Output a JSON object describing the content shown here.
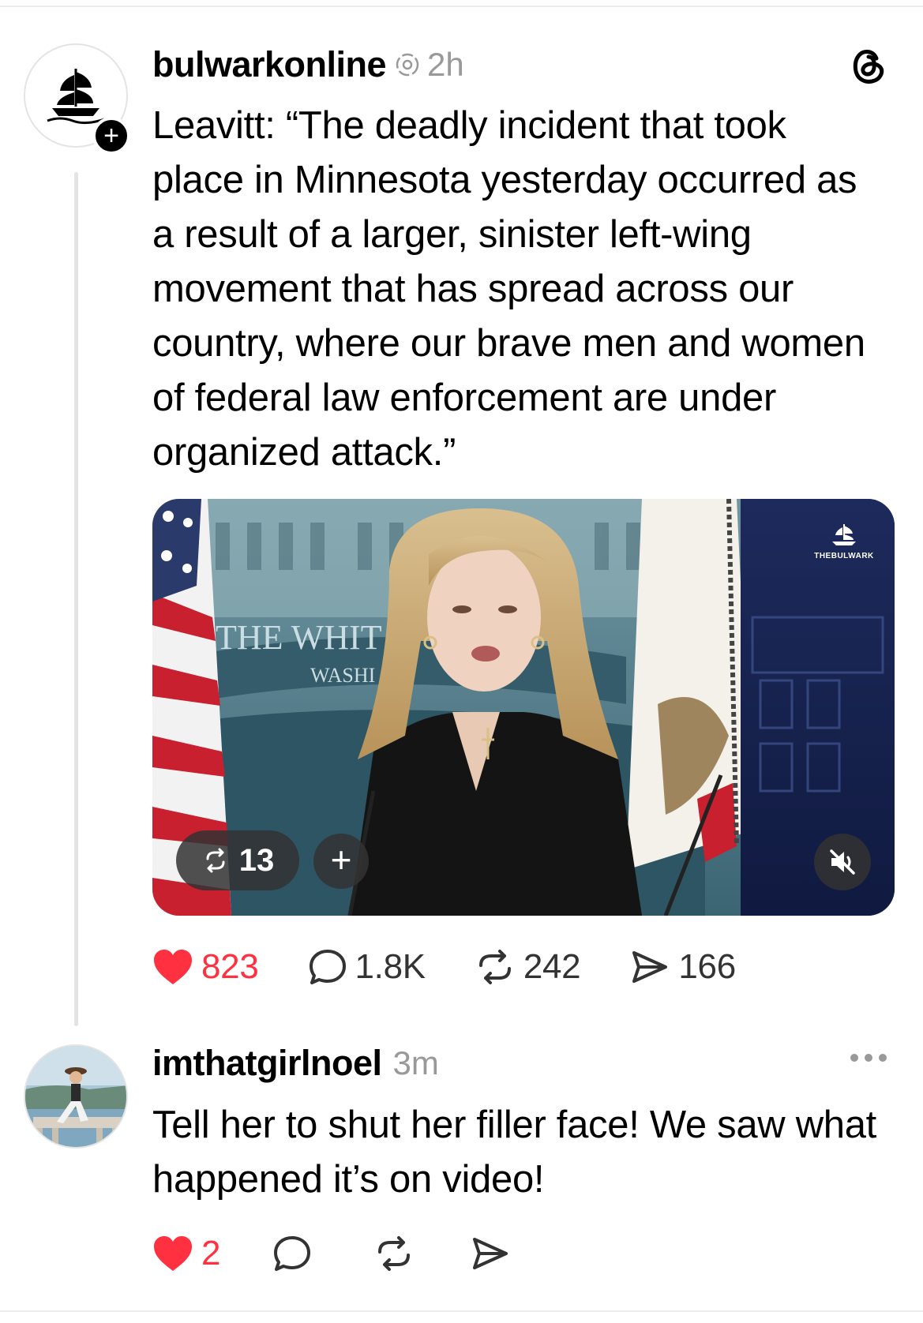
{
  "post": {
    "username": "bulwarkonline",
    "time": "2h",
    "text": "Leavitt: “The deadly incident that took place in Minnesota yesterday occurred as a result of a larger, sinister left-wing movement that has spread across our country, where our brave men and women of federal law enforcement are under organized attack.”",
    "video": {
      "repost_count": "13",
      "watermark": "THEBULWARK",
      "backdrop_text_1": "THE WHIT",
      "backdrop_text_2": "WASHI"
    },
    "actions": {
      "likes": "823",
      "replies": "1.8K",
      "reposts": "242",
      "shares": "166"
    }
  },
  "comment": {
    "username": "imthatgirlnoel",
    "time": "3m",
    "text": "Tell her to shut her filler face! We saw what happened it’s on video!",
    "likes": "2"
  },
  "colors": {
    "like_red": "#ff3040",
    "muted_gray": "#999999",
    "icon_gray": "#333333"
  },
  "icons": {
    "threads_logo": "threads-logo-icon",
    "heart": "heart-icon",
    "reply": "reply-bubble-icon",
    "repost": "repost-icon",
    "share": "share-send-icon",
    "mute": "muted-speaker-icon",
    "more": "more-dots-icon"
  }
}
